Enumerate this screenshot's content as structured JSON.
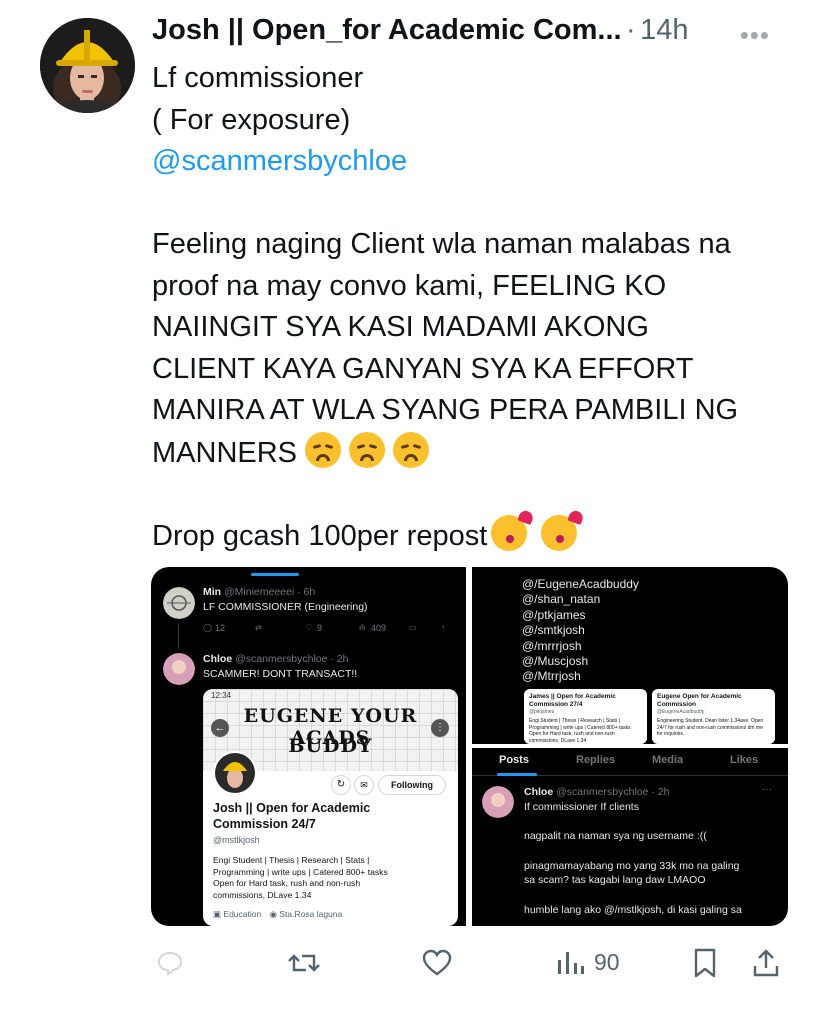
{
  "tweet": {
    "display_name": "Josh || Open_for Academic Com...",
    "separator": "·",
    "time": "14h",
    "lines": [
      "Lf commissioner",
      "( For exposure)"
    ],
    "mention": "@scanmersbychloe",
    "paragraph_lines": [
      "Feeling naging Client wla naman malabas na",
      "proof na may convo kami, FEELING KO",
      "NAIINGIT SYA KASI MADAMI AKONG",
      "CLIENT KAYA GANYAN SYA KA EFFORT",
      "MANIRA AT WLA SYANG PERA PAMBILI NG",
      "MANNERS"
    ],
    "closing_line": "Drop gcash 100per repost"
  },
  "media": {
    "left": {
      "post1_name": "Min",
      "post1_handle": "@Miniemeeeei · 6h",
      "post1_text": "LF COMMISSIONER (Engineering)",
      "post1_replies": "12",
      "post1_likes": "9",
      "post1_views": "409",
      "post2_name": "Chloe",
      "post2_handle": "@scanmersbychloe · 2h",
      "post2_text": "SCAMMER! DONT TRANSACT!!",
      "status_time": "12:34",
      "banner_line1": "EUGENE YOUR ACADS",
      "banner_line2": "BUDDY",
      "following_label": "Following",
      "profile_name_line1": "Josh || Open for Academic",
      "profile_name_line2": "Commission 24/7",
      "profile_handle": "@mstlkjosh",
      "bio_lines": [
        "Engi Student | Thesis | Research | Stats |",
        "Programming | write ups | Catered 800+ tasks",
        "Open for Hard task, rush and non-rush",
        "commissions, DLave 1.34"
      ],
      "meta_education": "Education",
      "meta_location": "Sta.Rosa laguna"
    },
    "top_right": {
      "handles": [
        "@/EugeneAcadbuddy",
        "@/shan_natan",
        "@/ptkjames",
        "@/smtkjosh",
        "@/mrrrjosh",
        "@/Muscjosh",
        "@/Mtrrjosh"
      ],
      "card1_name": "James || Open for Academic Commission 27/4",
      "card1_handle": "@ptkjames",
      "card1_bio": "Engi Student | Thesis | Research | Stats | Programming | write ups | Catered 800+ tasks Open for Hard task, rush and non-rush commissions, DLave 1.34",
      "card2_name": "Eugene Open for Academic Commission",
      "card2_handle": "@EugeneAcadbuddy",
      "card2_bio": "Engineering Student, Dean lister 1.34ave. Open 24/7 for rush and non-rush commissions dm me for inquiries."
    },
    "bottom_right": {
      "tabs": [
        "Posts",
        "Replies",
        "Media",
        "Likes"
      ],
      "name": "Chloe",
      "handle": "@scanmersbychloe · 2h",
      "line1": "If commissioner If clients",
      "line2": "nagpalit na naman sya ng username :((",
      "line3": "pinagmamayabang mo yang 33k mo na galing",
      "line4": "sa scam? tas kagabi lang daw LMAOO",
      "line5": "humble lang ako @/mstlkjosh, di kasi galing sa"
    }
  },
  "actions": {
    "views_count": "90"
  },
  "colors": {
    "accent": "#1d9bf0",
    "text": "#0f1419",
    "muted": "#536471"
  },
  "icons": [
    "reply-icon",
    "retweet-icon",
    "like-icon",
    "views-icon",
    "bookmark-icon",
    "share-icon",
    "more-icon"
  ]
}
